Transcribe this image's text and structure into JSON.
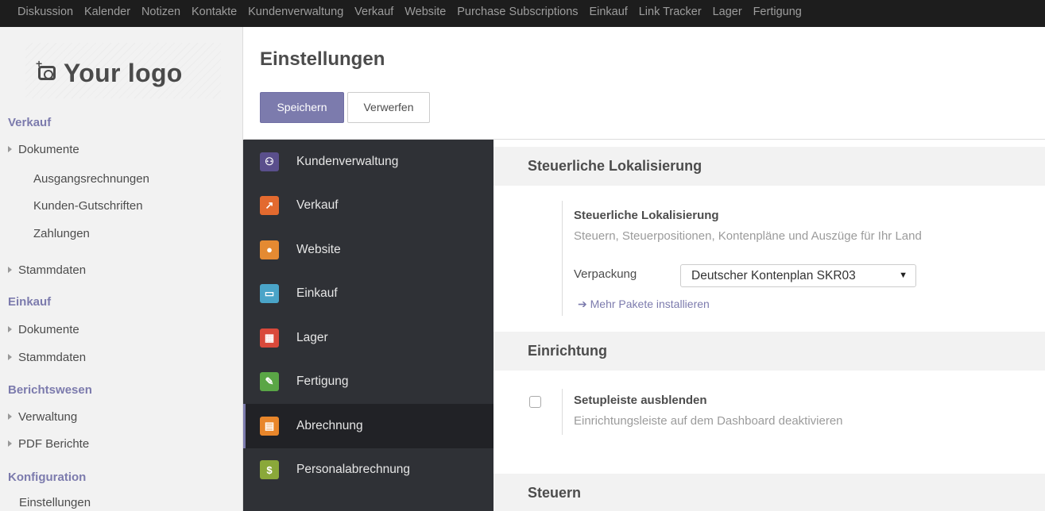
{
  "topnav": [
    "Diskussion",
    "Kalender",
    "Notizen",
    "Kontakte",
    "Kundenverwaltung",
    "Verkauf",
    "Website",
    "Purchase Subscriptions",
    "Einkauf",
    "Link Tracker",
    "Lager",
    "Fertigung"
  ],
  "logo": {
    "text": "Your logo"
  },
  "sidebar": {
    "verkauf": "Verkauf",
    "dokumente": "Dokumente",
    "ausgangsrechnungen": "Ausgangsrechnungen",
    "kunden_gutschriften": "Kunden-Gutschriften",
    "zahlungen": "Zahlungen",
    "stammdaten": "Stammdaten",
    "einkauf": "Einkauf",
    "einkauf_dokumente": "Dokumente",
    "einkauf_stammdaten": "Stammdaten",
    "berichtswesen": "Berichtswesen",
    "verwaltung": "Verwaltung",
    "pdf_berichte": "PDF Berichte",
    "konfiguration": "Konfiguration",
    "einstellungen": "Einstellungen"
  },
  "header": {
    "title": "Einstellungen",
    "save_label": "Speichern",
    "discard_label": "Verwerfen"
  },
  "apps": [
    {
      "label": "Kundenverwaltung",
      "icon": "handshake-icon",
      "color": "#5a4f8c"
    },
    {
      "label": "Verkauf",
      "icon": "chart-line-icon",
      "color": "#e36a2f"
    },
    {
      "label": "Website",
      "icon": "globe-icon",
      "color": "#e48a32"
    },
    {
      "label": "Einkauf",
      "icon": "credit-card-icon",
      "color": "#4aa4c8"
    },
    {
      "label": "Lager",
      "icon": "box-icon",
      "color": "#d9493b"
    },
    {
      "label": "Fertigung",
      "icon": "wrench-icon",
      "color": "#5aa646"
    },
    {
      "label": "Abrechnung",
      "icon": "invoice-icon",
      "color": "#e8862b"
    },
    {
      "label": "Personalabrechnung",
      "icon": "payroll-icon",
      "color": "#8aa83a"
    }
  ],
  "content": {
    "sec1_title": "Steuerliche Lokalisierung",
    "setting1_title": "Steuerliche Lokalisierung",
    "setting1_desc": "Steuern, Steuerpositionen, Kontenpläne und Auszüge für Ihr Land",
    "package_label": "Verpackung",
    "package_value": "Deutscher Kontenplan SKR03",
    "more_link": "Mehr Pakete installieren",
    "sec2_title": "Einrichtung",
    "setting2_title": "Setupleiste ausblenden",
    "setting2_desc": "Einrichtungsleiste auf dem Dashboard deaktivieren",
    "sec3_title": "Steuern"
  },
  "colors": {
    "accent": "#7c7bad",
    "topbar": "#1d1d1d",
    "app_menu": "#2f3136"
  }
}
